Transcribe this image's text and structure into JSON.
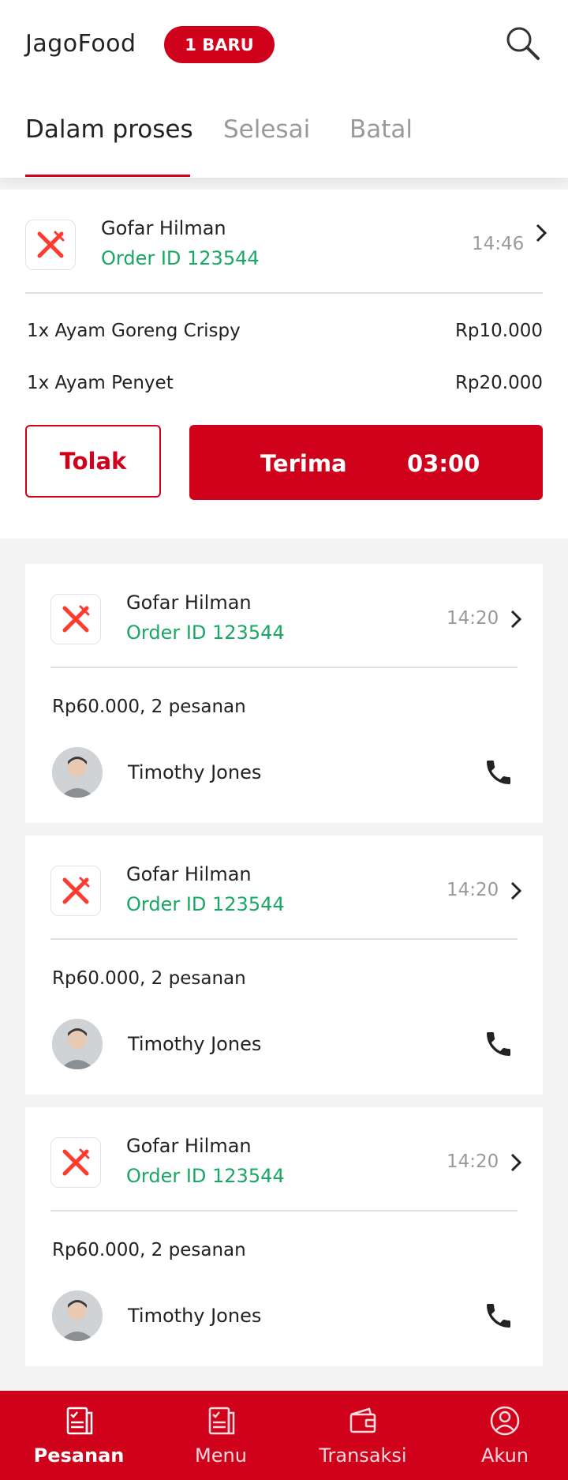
{
  "header": {
    "app_title": "JagoFood",
    "badge": "1 BARU",
    "tabs": [
      {
        "label": "Dalam proses",
        "active": true
      },
      {
        "label": "Selesai",
        "active": false
      },
      {
        "label": "Batal",
        "active": false
      }
    ]
  },
  "new_order": {
    "customer": "Gofar Hilman",
    "order_id": "Order ID 123544",
    "time": "14:46",
    "items": [
      {
        "name": "1x Ayam Goreng Crispy",
        "price": "Rp10.000"
      },
      {
        "name": "1x Ayam Penyet",
        "price": "Rp20.000"
      }
    ],
    "reject_label": "Tolak",
    "accept_label": "Terima",
    "countdown": "03:00"
  },
  "orders": [
    {
      "customer": "Gofar Hilman",
      "order_id": "Order ID 123544",
      "time": "14:20",
      "summary": "Rp60.000, 2 pesanan",
      "driver": "Timothy Jones"
    },
    {
      "customer": "Gofar Hilman",
      "order_id": "Order ID 123544",
      "time": "14:20",
      "summary": "Rp60.000, 2 pesanan",
      "driver": "Timothy Jones"
    },
    {
      "customer": "Gofar Hilman",
      "order_id": "Order ID 123544",
      "time": "14:20",
      "summary": "Rp60.000, 2 pesanan",
      "driver": "Timothy Jones"
    }
  ],
  "bottom_nav": [
    {
      "label": "Pesanan",
      "icon": "orders-icon",
      "active": true
    },
    {
      "label": "Menu",
      "icon": "menu-icon",
      "active": false
    },
    {
      "label": "Transaksi",
      "icon": "wallet-icon",
      "active": false
    },
    {
      "label": "Akun",
      "icon": "account-icon",
      "active": false
    }
  ],
  "colors": {
    "brand": "#d0021b",
    "order_id": "#17a862",
    "muted": "#9a9a9a"
  }
}
